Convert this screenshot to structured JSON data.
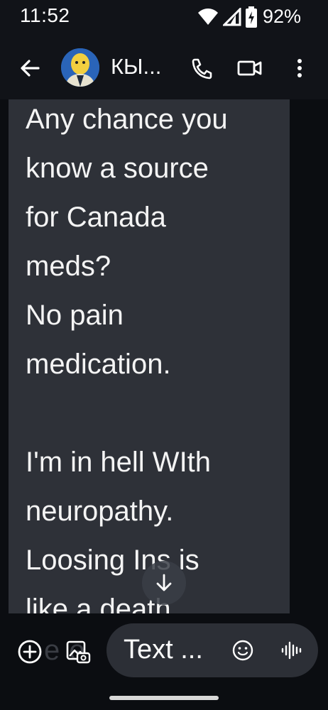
{
  "status_bar": {
    "time": "11:52",
    "battery_percent": "92%",
    "wifi_icon": "wifi-icon",
    "signal_icon": "signal-icon",
    "battery_icon": "battery-charging-icon"
  },
  "app_bar": {
    "back_icon": "arrow-back-icon",
    "avatar_icon": "contact-avatar",
    "contact_name": "КЫ...",
    "call_icon": "phone-icon",
    "video_icon": "video-camera-icon",
    "menu_icon": "more-vert-icon"
  },
  "conversation": {
    "message_text": "Any chance you\nknow a source\nfor Canada\nmeds?\nNo pain\nmedication.\n\nI'm in hell WIth\nneuropathy.\nLoosing Ins is\nlike a death",
    "scroll_icon": "arrow-down-icon"
  },
  "compose": {
    "ghost_text": "e e",
    "placeholder": "Text ...",
    "add_icon": "add-circle-icon",
    "gallery_icon": "gallery-icon",
    "emoji_icon": "emoji-icon",
    "voice_icon": "voice-wave-icon"
  },
  "colors": {
    "background": "#0b0d11",
    "bar": "#111318",
    "bubble": "#2e3138",
    "field": "#2c2f36"
  }
}
